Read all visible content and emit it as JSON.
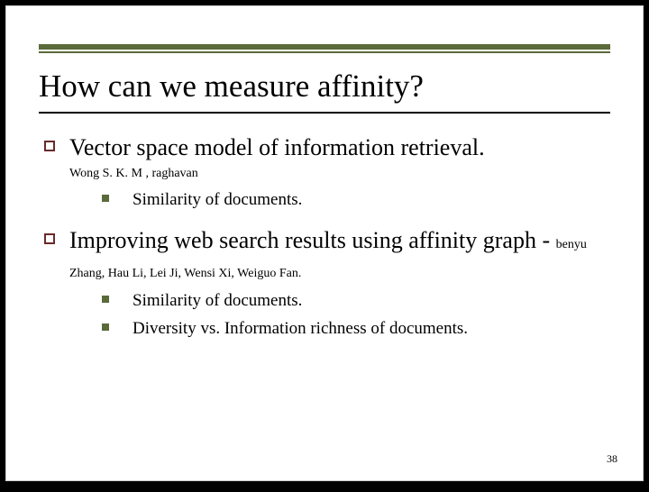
{
  "title": "How can we measure affinity?",
  "items": [
    {
      "text": "Vector space model of information retrieval.",
      "authors_below": "Wong S. K. M , raghavan",
      "sub": [
        "Similarity of documents."
      ]
    },
    {
      "text": "Improving web search results using affinity graph - ",
      "authors_inline": "benyu Zhang, Hau Li, Lei Ji, Wensi Xi, Weiguo Fan.",
      "sub": [
        "Similarity of documents.",
        "Diversity vs. Information richness of documents."
      ]
    }
  ],
  "page_number": "38",
  "dash_suffix": "- "
}
